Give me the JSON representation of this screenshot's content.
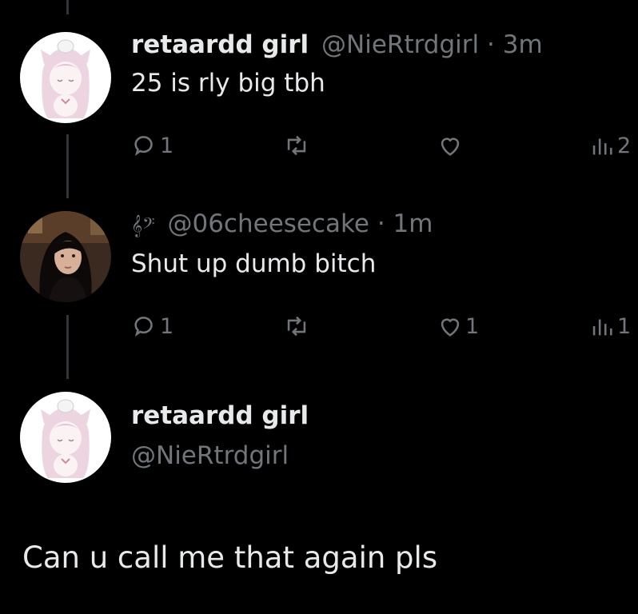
{
  "colors": {
    "background": "#000000",
    "text": "#e7e9ea",
    "muted": "#71767b",
    "thread_line": "#333639"
  },
  "tweets": [
    {
      "display_name": "retaardd girl",
      "handle": "@NieRtrdgirl",
      "separator": "·",
      "time": "3m",
      "text": "25 is rly big tbh",
      "avatar": "anime-girl-pink-hair-avatar",
      "reply_count": "1",
      "retweet_count": "",
      "like_count": "",
      "view_count": "2"
    },
    {
      "display_name": "𝄞𝄢",
      "handle": "@06cheesecake",
      "separator": "·",
      "time": "1m",
      "text": "Shut up dumb bitch",
      "avatar": "dark-hair-woman-photo-avatar",
      "reply_count": "1",
      "retweet_count": "",
      "like_count": "1",
      "view_count": "1"
    }
  ],
  "focused_tweet": {
    "display_name": "retaardd girl",
    "handle": "@NieRtrdgirl",
    "text": "Can u call me that again pls",
    "avatar": "anime-girl-pink-hair-avatar"
  },
  "icons": {
    "reply": "reply-bubble-icon",
    "retweet": "retweet-icon",
    "like": "heart-icon",
    "views": "views-bar-icon"
  }
}
